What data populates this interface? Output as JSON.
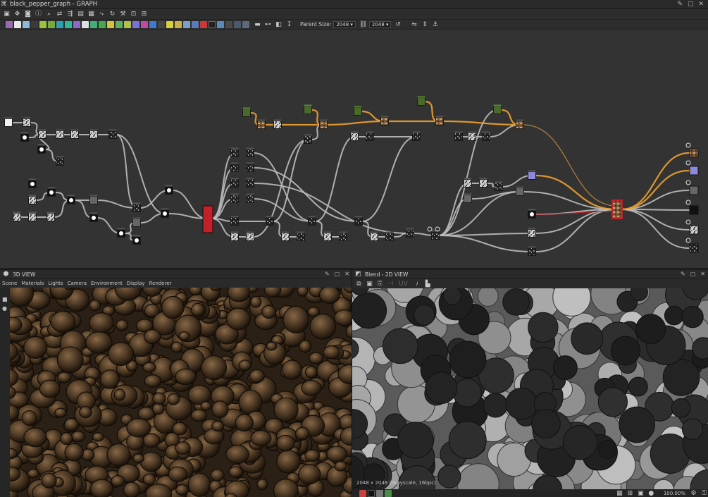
{
  "window": {
    "title": "black_pepper_graph - GRAPH"
  },
  "toolbar": {
    "parent_size_label": "Parent Size:",
    "parent_size_value": "2048",
    "size_value": "2048"
  },
  "panes": {
    "view3d": {
      "title": "3D VIEW",
      "menu": [
        "Scene",
        "Materials",
        "Lights",
        "Camera",
        "Environment",
        "Display",
        "Renderer"
      ]
    },
    "view2d": {
      "title": "Blend - 2D VIEW",
      "info": "2048 x 2048 (Grayscale, 16bpc)",
      "zoom": "100.00%",
      "uv_label": "UV"
    }
  },
  "colors": {
    "accent_orange": "#f0a030",
    "output_red": "#c4202a",
    "graph_bg": "#333333"
  }
}
